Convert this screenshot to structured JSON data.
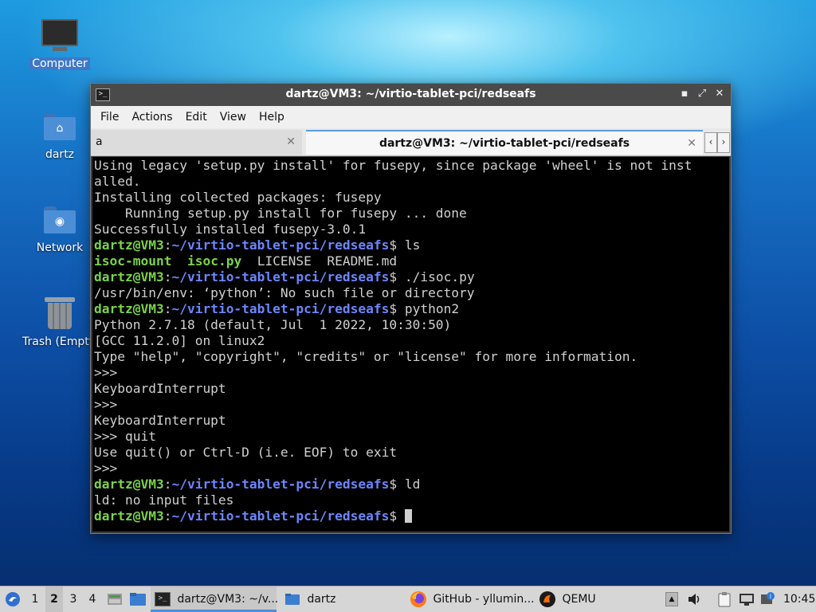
{
  "desktop": {
    "icons": [
      {
        "label": "Computer"
      },
      {
        "label": "dartz"
      },
      {
        "label": "Network"
      },
      {
        "label": "Trash (Empty)"
      }
    ]
  },
  "window": {
    "title": "dartz@VM3: ~/virtio-tablet-pci/redseafs",
    "menu": [
      "File",
      "Actions",
      "Edit",
      "View",
      "Help"
    ],
    "tabs": [
      {
        "label": "a",
        "active": false
      },
      {
        "label": "dartz@VM3: ~/virtio-tablet-pci/redseafs",
        "active": true
      }
    ]
  },
  "colors": {
    "prompt_user": "#7ad34a",
    "prompt_path": "#6b86ff",
    "default_text": "#d0d0d0",
    "taskbar_accent": "#4a8fe0"
  },
  "terminal": {
    "lines": [
      [
        {
          "t": "Using legacy 'setup.py install' for fusepy, since package 'wheel' is not inst"
        }
      ],
      [
        {
          "t": "alled."
        }
      ],
      [
        {
          "t": "Installing collected packages: fusepy"
        }
      ],
      [
        {
          "t": "    Running setup.py install for fusepy ... done"
        }
      ],
      [
        {
          "t": "Successfully installed fusepy-3.0.1"
        }
      ],
      [
        {
          "t": "dartz@VM3",
          "c": "user"
        },
        {
          "t": ":"
        },
        {
          "t": "~/virtio-tablet-pci/redseafs",
          "c": "path"
        },
        {
          "t": "$ ls"
        }
      ],
      [
        {
          "t": "isoc-mount",
          "c": "user"
        },
        {
          "t": "  "
        },
        {
          "t": "isoc.py",
          "c": "user"
        },
        {
          "t": "  LICENSE  README.md"
        }
      ],
      [
        {
          "t": "dartz@VM3",
          "c": "user"
        },
        {
          "t": ":"
        },
        {
          "t": "~/virtio-tablet-pci/redseafs",
          "c": "path"
        },
        {
          "t": "$ ./isoc.py"
        }
      ],
      [
        {
          "t": "/usr/bin/env: ‘python’: No such file or directory"
        }
      ],
      [
        {
          "t": "dartz@VM3",
          "c": "user"
        },
        {
          "t": ":"
        },
        {
          "t": "~/virtio-tablet-pci/redseafs",
          "c": "path"
        },
        {
          "t": "$ python2"
        }
      ],
      [
        {
          "t": "Python 2.7.18 (default, Jul  1 2022, 10:30:50)"
        }
      ],
      [
        {
          "t": "[GCC 11.2.0] on linux2"
        }
      ],
      [
        {
          "t": "Type \"help\", \"copyright\", \"credits\" or \"license\" for more information."
        }
      ],
      [
        {
          "t": ">>>"
        }
      ],
      [
        {
          "t": "KeyboardInterrupt"
        }
      ],
      [
        {
          "t": ">>>"
        }
      ],
      [
        {
          "t": "KeyboardInterrupt"
        }
      ],
      [
        {
          "t": ">>> quit"
        }
      ],
      [
        {
          "t": "Use quit() or Ctrl-D (i.e. EOF) to exit"
        }
      ],
      [
        {
          "t": ">>>"
        }
      ],
      [
        {
          "t": "dartz@VM3",
          "c": "user"
        },
        {
          "t": ":"
        },
        {
          "t": "~/virtio-tablet-pci/redseafs",
          "c": "path"
        },
        {
          "t": "$ ld"
        }
      ],
      [
        {
          "t": "ld: no input files"
        }
      ],
      [
        {
          "t": "dartz@VM3",
          "c": "user"
        },
        {
          "t": ":"
        },
        {
          "t": "~/virtio-tablet-pci/redseafs",
          "c": "path"
        },
        {
          "t": "$ "
        },
        {
          "cursor": true
        }
      ]
    ]
  },
  "taskbar": {
    "workspaces": [
      "1",
      "2",
      "3",
      "4"
    ],
    "active_workspace": "2",
    "tasks": [
      {
        "label": "dartz@VM3: ~/v...",
        "icon": "terminal-icon"
      },
      {
        "label": "dartz",
        "icon": "folder-icon"
      },
      {
        "label": "GitHub - yllumin...",
        "icon": "firefox-icon"
      },
      {
        "label": "QEMU",
        "icon": "qemu-icon"
      }
    ],
    "clock": "10:45"
  }
}
